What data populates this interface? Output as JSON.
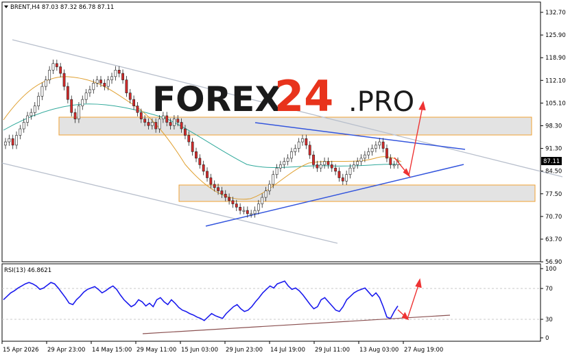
{
  "header": {
    "symbol_line": "BRENT,H4  87.03 87.32 86.78 87.11",
    "rsi_label": "RSI(13) 46.8621"
  },
  "watermark": {
    "part1": "FOREX",
    "part2": "24",
    "part3": ".PRO",
    "color_dark": "#1a1a1a",
    "color_accent": "#e8331c"
  },
  "price_axis": {
    "ticks": [
      "132.70",
      "125.90",
      "118.90",
      "112.10",
      "105.10",
      "98.30",
      "91.30",
      "84.50",
      "77.50",
      "70.70",
      "63.70",
      "56.90"
    ],
    "current_label": "87.11"
  },
  "rsi_axis": {
    "ticks": [
      "100",
      "70",
      "30",
      "0"
    ]
  },
  "time_axis": {
    "labels": [
      "15 Apr 2026",
      "29 Apr 23:00",
      "14 May 15:00",
      "29 May 11:00",
      "15 Jun 03:00",
      "29 Jun 23:00",
      "14 Jul 19:00",
      "29 Jul 11:00",
      "13 Aug 03:00",
      "27 Aug 19:00"
    ]
  },
  "chart_data": {
    "type": "candlestick",
    "symbol": "BRENT",
    "timeframe": "H4",
    "ohlc_last": {
      "open": 87.03,
      "high": 87.32,
      "low": 86.78,
      "close": 87.11
    },
    "ylim": [
      56.9,
      132.7
    ],
    "closes": [
      93,
      94,
      92,
      95,
      97,
      99,
      101,
      102,
      104,
      107,
      110,
      112,
      115,
      117,
      116,
      114,
      110,
      106,
      102,
      100,
      104,
      106,
      108,
      109,
      111,
      112,
      111,
      110,
      112,
      113,
      115,
      114,
      112,
      108,
      106,
      104,
      102,
      100,
      99,
      98,
      99,
      97,
      100,
      101,
      99,
      98,
      100,
      99,
      97,
      95,
      93,
      90,
      88,
      86,
      84,
      82,
      80,
      79,
      78,
      77,
      76,
      75,
      74,
      73,
      72,
      72,
      71,
      71,
      72,
      74,
      76,
      78,
      80,
      83,
      85,
      86,
      87,
      88,
      90,
      91,
      93,
      94,
      92,
      89,
      86,
      85,
      86,
      87,
      86,
      85,
      84,
      82,
      81,
      83,
      85,
      86,
      87,
      88,
      89,
      90,
      91,
      92,
      93,
      91,
      88,
      86,
      86,
      87
    ],
    "zones": [
      {
        "price_from": 96.0,
        "price_to": 100.8
      },
      {
        "price_from": 75.0,
        "price_to": 79.5
      }
    ],
    "rsi": {
      "period": 13,
      "last": 46.8621,
      "ylim": [
        0,
        100
      ],
      "levels": [
        70,
        30
      ],
      "values": [
        55,
        60,
        65,
        68,
        72,
        75,
        78,
        80,
        78,
        75,
        70,
        72,
        76,
        80,
        78,
        72,
        65,
        58,
        50,
        48,
        55,
        60,
        66,
        70,
        72,
        74,
        70,
        65,
        68,
        72,
        75,
        70,
        62,
        55,
        50,
        45,
        48,
        55,
        52,
        46,
        50,
        45,
        55,
        58,
        52,
        48,
        55,
        50,
        44,
        40,
        38,
        35,
        33,
        30,
        28,
        25,
        30,
        35,
        32,
        30,
        28,
        35,
        40,
        45,
        48,
        42,
        38,
        40,
        45,
        52,
        58,
        65,
        70,
        75,
        72,
        78,
        80,
        82,
        75,
        70,
        72,
        68,
        62,
        55,
        48,
        42,
        45,
        55,
        58,
        52,
        46,
        40,
        38,
        45,
        55,
        60,
        65,
        68,
        70,
        72,
        66,
        60,
        65,
        58,
        45,
        30,
        28,
        38,
        46
      ]
    }
  }
}
